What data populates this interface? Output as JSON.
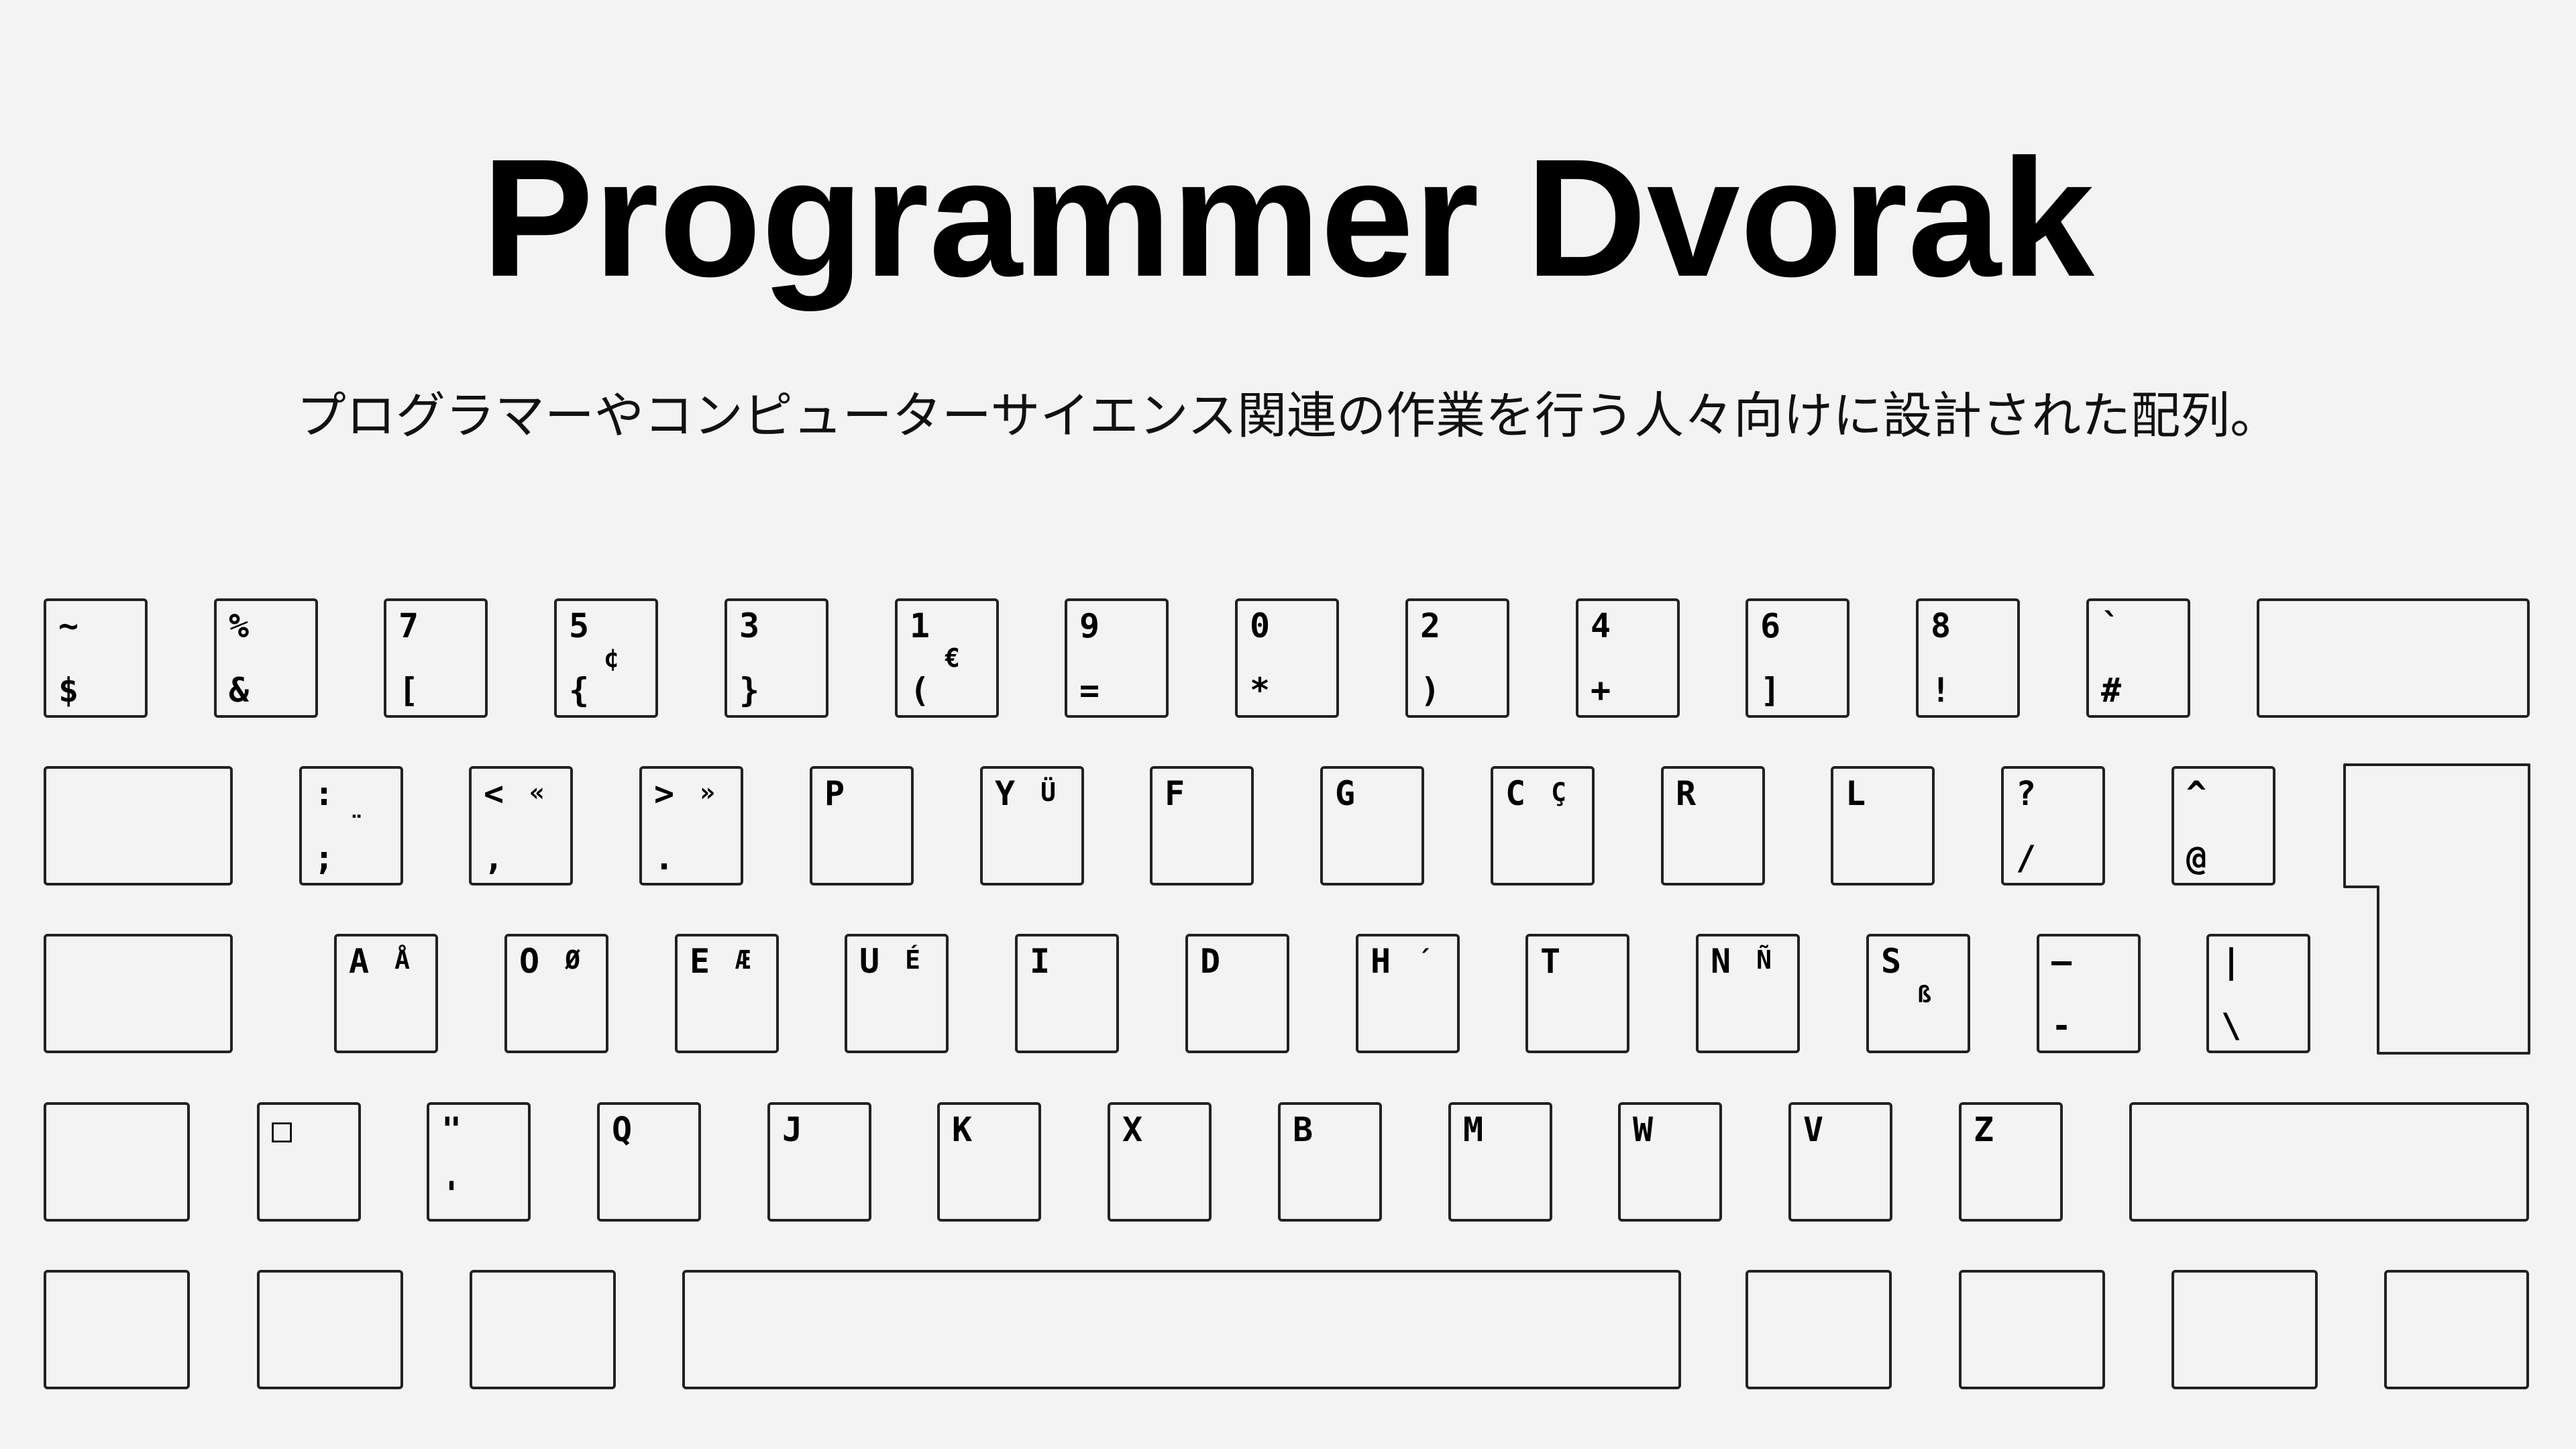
{
  "header": {
    "title": "Programmer Dvorak",
    "subtitle": "プログラマーやコンピューターサイエンス関連の作業を行う人々向けに設計された配列。"
  },
  "keyboard": {
    "rows": [
      [
        {
          "id": "tilde-dollar",
          "tl": "~",
          "bl": "$"
        },
        {
          "id": "percent-ampersand",
          "tl": "%",
          "bl": "&"
        },
        {
          "id": "7-bracket",
          "tl": "7",
          "bl": "["
        },
        {
          "id": "5-brace",
          "tl": "5",
          "bl": "{",
          "cr": "¢"
        },
        {
          "id": "3-brace",
          "tl": "3",
          "bl": "}"
        },
        {
          "id": "1-paren",
          "tl": "1",
          "bl": "(",
          "cr": "€"
        },
        {
          "id": "9-equals",
          "tl": "9",
          "bl": "="
        },
        {
          "id": "0-asterisk",
          "tl": "0",
          "bl": "*"
        },
        {
          "id": "2-paren",
          "tl": "2",
          "bl": ")"
        },
        {
          "id": "4-plus",
          "tl": "4",
          "bl": "+"
        },
        {
          "id": "6-bracket",
          "tl": "6",
          "bl": "]"
        },
        {
          "id": "8-exclaim",
          "tl": "8",
          "bl": "!"
        },
        {
          "id": "backtick-hash",
          "tl": "`",
          "bl": "#"
        },
        {
          "id": "backspace"
        }
      ],
      [
        {
          "id": "tab"
        },
        {
          "id": "colon-semicolon",
          "tl": ":",
          "bl": ";",
          "cr": "¨"
        },
        {
          "id": "less-comma",
          "tl": "<",
          "bl": ",",
          "tr": "«"
        },
        {
          "id": "greater-period",
          "tl": ">",
          "bl": ".",
          "tr": "»"
        },
        {
          "id": "p",
          "tl": "P"
        },
        {
          "id": "y",
          "tl": "Y",
          "tr": "Ü"
        },
        {
          "id": "f",
          "tl": "F"
        },
        {
          "id": "g",
          "tl": "G"
        },
        {
          "id": "c",
          "tl": "C",
          "tr": "Ç"
        },
        {
          "id": "r",
          "tl": "R"
        },
        {
          "id": "l",
          "tl": "L"
        },
        {
          "id": "question-slash",
          "tl": "?",
          "bl": "/"
        },
        {
          "id": "caret-at",
          "tl": "^",
          "bl": "@"
        }
      ],
      [
        {
          "id": "caps-lock"
        },
        {
          "id": "a",
          "tl": "A",
          "tr": "Å"
        },
        {
          "id": "o",
          "tl": "O",
          "tr": "Ø"
        },
        {
          "id": "e",
          "tl": "E",
          "tr": "Æ"
        },
        {
          "id": "u",
          "tl": "U",
          "tr": "É"
        },
        {
          "id": "i",
          "tl": "I"
        },
        {
          "id": "d",
          "tl": "D"
        },
        {
          "id": "h",
          "tl": "H",
          "tr": "´"
        },
        {
          "id": "t",
          "tl": "T"
        },
        {
          "id": "n",
          "tl": "N",
          "tr": "Ñ"
        },
        {
          "id": "s",
          "tl": "S",
          "br": "ß"
        },
        {
          "id": "dash-minus",
          "tl": "—",
          "bl": "-"
        },
        {
          "id": "pipe-backslash",
          "tl": "|",
          "bl": "\\"
        }
      ],
      [
        {
          "id": "left-shift"
        },
        {
          "id": "square",
          "tl": "□"
        },
        {
          "id": "quote",
          "tl": "\"",
          "bl": "'"
        },
        {
          "id": "q",
          "tl": "Q"
        },
        {
          "id": "j",
          "tl": "J"
        },
        {
          "id": "k",
          "tl": "K"
        },
        {
          "id": "x",
          "tl": "X"
        },
        {
          "id": "b",
          "tl": "B"
        },
        {
          "id": "m",
          "tl": "M"
        },
        {
          "id": "w",
          "tl": "W"
        },
        {
          "id": "v",
          "tl": "V"
        },
        {
          "id": "z",
          "tl": "Z"
        },
        {
          "id": "right-shift"
        }
      ],
      [
        {
          "id": "left-ctrl"
        },
        {
          "id": "left-super"
        },
        {
          "id": "left-alt"
        },
        {
          "id": "space"
        },
        {
          "id": "right-alt"
        },
        {
          "id": "right-super"
        },
        {
          "id": "menu"
        },
        {
          "id": "right-ctrl"
        }
      ]
    ]
  }
}
